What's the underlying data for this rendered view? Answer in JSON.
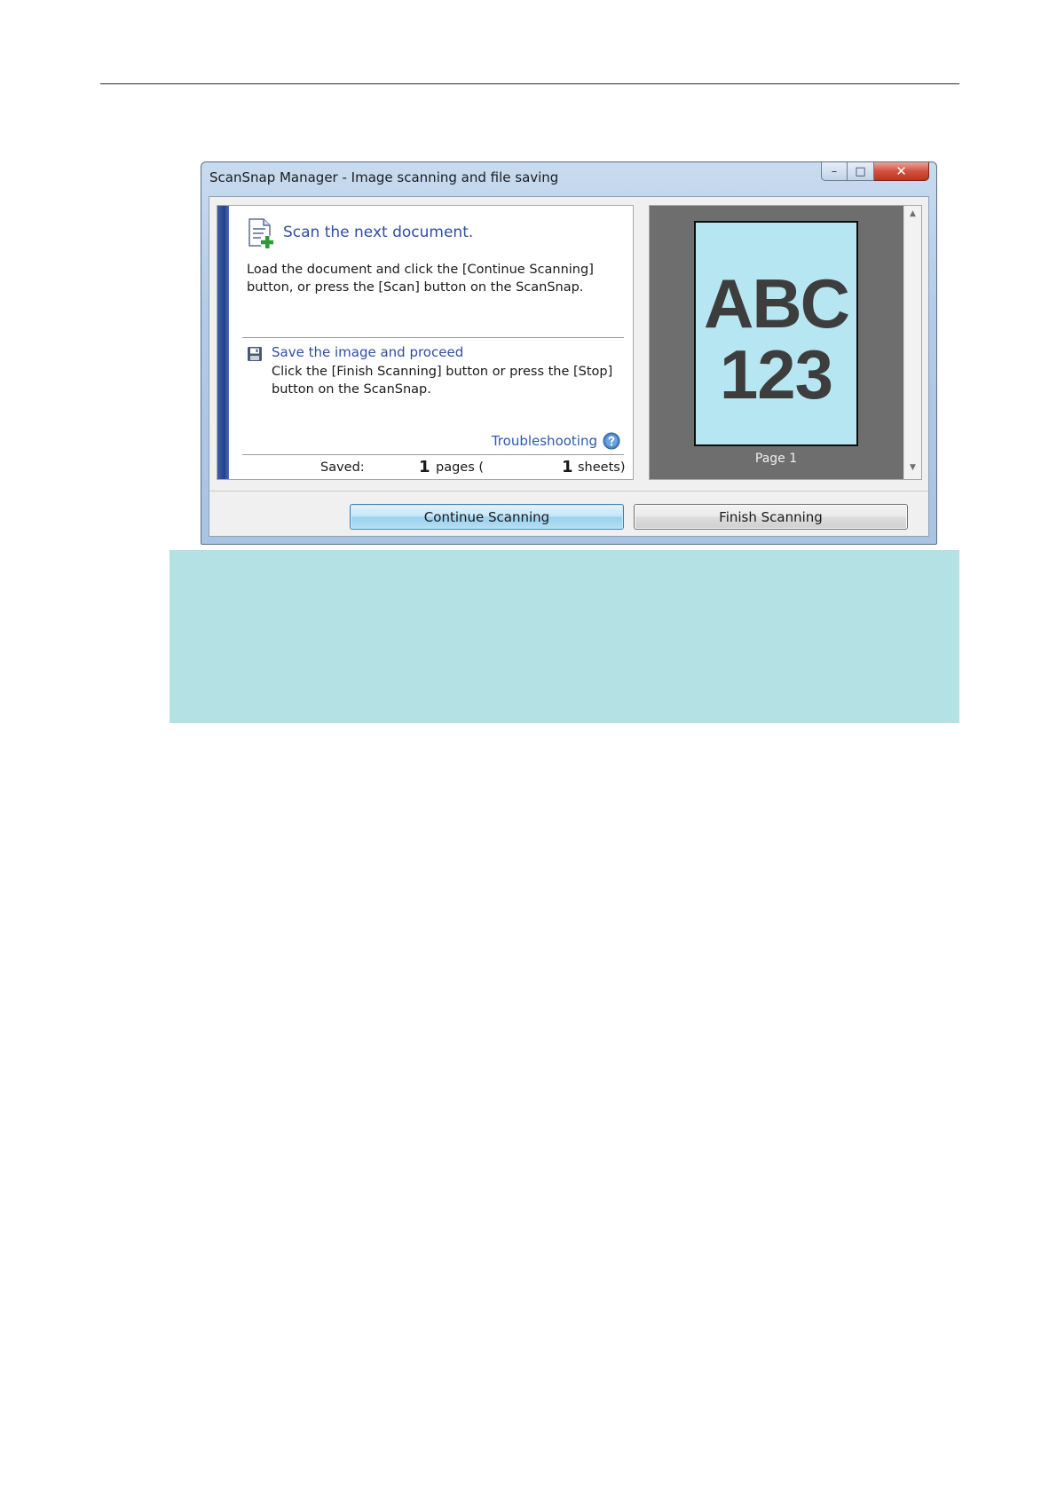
{
  "window": {
    "title": "ScanSnap Manager - Image scanning and file saving",
    "caption": {
      "minimize": "–",
      "maximize": "□",
      "close": "✕"
    }
  },
  "message": {
    "next_title": "Scan the next document.",
    "next_body": "Load the document and click the [Continue Scanning] button, or press the [Scan] button on the ScanSnap.",
    "save_title": "Save the image and proceed",
    "save_body": "Click the [Finish Scanning] button or press the [Stop] button on the ScanSnap.",
    "troubleshooting": "Troubleshooting",
    "saved_label": "Saved:",
    "pages_count": "1",
    "pages_label": "pages (",
    "sheets_count": "1",
    "sheets_label": "sheets)"
  },
  "preview": {
    "thumb_line1": "ABC",
    "thumb_line2": "123",
    "page_label": "Page 1",
    "scroll_up": "▲",
    "scroll_down": "▼"
  },
  "buttons": {
    "continue": "Continue Scanning",
    "finish": "Finish Scanning"
  },
  "colors": {
    "link_blue": "#2f4ea3",
    "stripe_blue": "#24418a",
    "preview_bg": "#6e6e6e",
    "thumb_bg": "#b7e6f3",
    "note_bg": "#b3e1e4"
  }
}
